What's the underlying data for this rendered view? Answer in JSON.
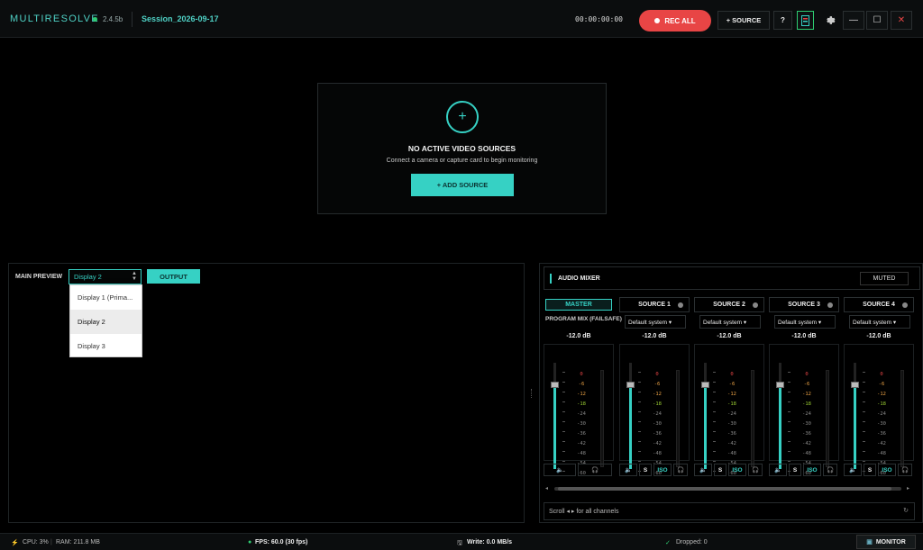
{
  "app": {
    "title": "MULTIRESOLVE",
    "version": "2.4.5b",
    "session": "Session_2026-09-17",
    "timecode": "00:00:00:00",
    "accent_color": "#36d1c4",
    "record_color": "#e84545"
  },
  "toolbar": {
    "rec_all": "REC ALL",
    "add_source": "+ SOURCE",
    "help": "?",
    "minimize": "—",
    "maximize": "☐",
    "close": "✕"
  },
  "empty_state": {
    "icon": "+",
    "title": "NO ACTIVE VIDEO SOURCES",
    "subtitle": "Connect a camera or capture card to begin monitoring",
    "button": "+  ADD SOURCE"
  },
  "preview": {
    "label": "MAIN PREVIEW",
    "selected": "Display 2",
    "output_button": "OUTPUT",
    "options": [
      "Display 1 (Prima...",
      "Display 2",
      "Display 3"
    ]
  },
  "mixer": {
    "title": "AUDIO MIXER",
    "muted_button": "MUTED",
    "scale": [
      "0",
      "-6",
      "-12",
      "-18",
      "-24",
      "-30",
      "-36",
      "-42",
      "-48",
      "-54",
      "-60"
    ],
    "channels": [
      {
        "name": "MASTER",
        "sub": "PROGRAM MIX (FAILSAFE)",
        "db": "-12.0 dB",
        "level": 0.8
      },
      {
        "name": "SOURCE 1",
        "device": "Default system",
        "db": "-12.0 dB",
        "level": 0.8,
        "solo": "S",
        "iso": "ISO"
      },
      {
        "name": "SOURCE 2",
        "device": "Default system",
        "db": "-12.0 dB",
        "level": 0.8,
        "solo": "S",
        "iso": "ISO"
      },
      {
        "name": "SOURCE 3",
        "device": "Default system",
        "db": "-12.0 dB",
        "level": 0.8,
        "solo": "S",
        "iso": "ISO"
      },
      {
        "name": "SOURCE 4",
        "device": "Default system",
        "db": "-12.0 dB",
        "level": 0.8,
        "solo": "S",
        "iso": "ISO"
      }
    ],
    "scroll_hint": "Scroll ◂ ▸ for all channels"
  },
  "status": {
    "cpu": "CPU: 3%",
    "ram": "RAM: 211.8 MB",
    "fps": "FPS: 60.0 (30 fps)",
    "write": "Write: 0.0 MB/s",
    "dropped": "Dropped: 0",
    "monitor": "MONITOR"
  }
}
